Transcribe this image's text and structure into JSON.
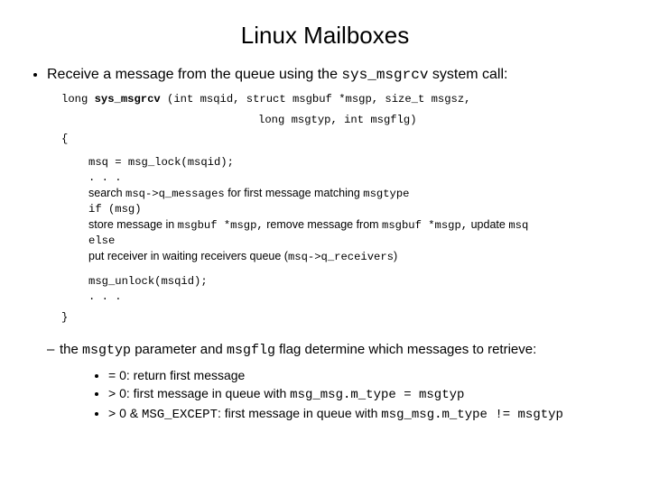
{
  "title": "Linux Mailboxes",
  "bullet1": {
    "pre": "Receive a message from the queue using the ",
    "code": "sys_msgrcv",
    "post": " system call:"
  },
  "sig": {
    "line1a": "long ",
    "line1b": "sys_msgrcv",
    "line1c": " (int msqid, struct msgbuf *msgp, size_t msgsz,",
    "line2": "long msgtyp, int msgflg)"
  },
  "body": {
    "brace_open": "{",
    "l1": "msq = msg_lock(msqid);",
    "l2": ". . .",
    "l3_pre": "search ",
    "l3_code": "msq->q_messages",
    "l3_mid": " for first message matching ",
    "l3_code2": "msgtype",
    "l4": "if (msg)",
    "l5_pre": "store message in ",
    "l5_c1": "msgbuf *msgp,",
    "l5_mid": " remove message from ",
    "l5_c2": "msgbuf *msgp,",
    "l5_post": " update ",
    "l5_c3": "msq",
    "l6": "else",
    "l7_pre": "put receiver in waiting receivers queue (",
    "l7_code": "msq->q_receivers",
    "l7_post": ")",
    "l8": "msg_unlock(msqid);",
    "l9": ". . .",
    "brace_close": "}"
  },
  "sub": {
    "pre": "the ",
    "c1": "msgtyp",
    "mid1": " parameter and ",
    "c2": "msgflg",
    "post": " flag determine which messages to retrieve:"
  },
  "inner": {
    "i1": "= 0: return first message",
    "i2_pre": "> 0: first message in queue with ",
    "i2_code": "msg_msg.m_type = msgtyp",
    "i3_pre": "> 0 & ",
    "i3_c1": "MSG_EXCEPT",
    "i3_mid": ": first message in queue with ",
    "i3_c2": "msg_msg.m_type != msgtyp"
  }
}
